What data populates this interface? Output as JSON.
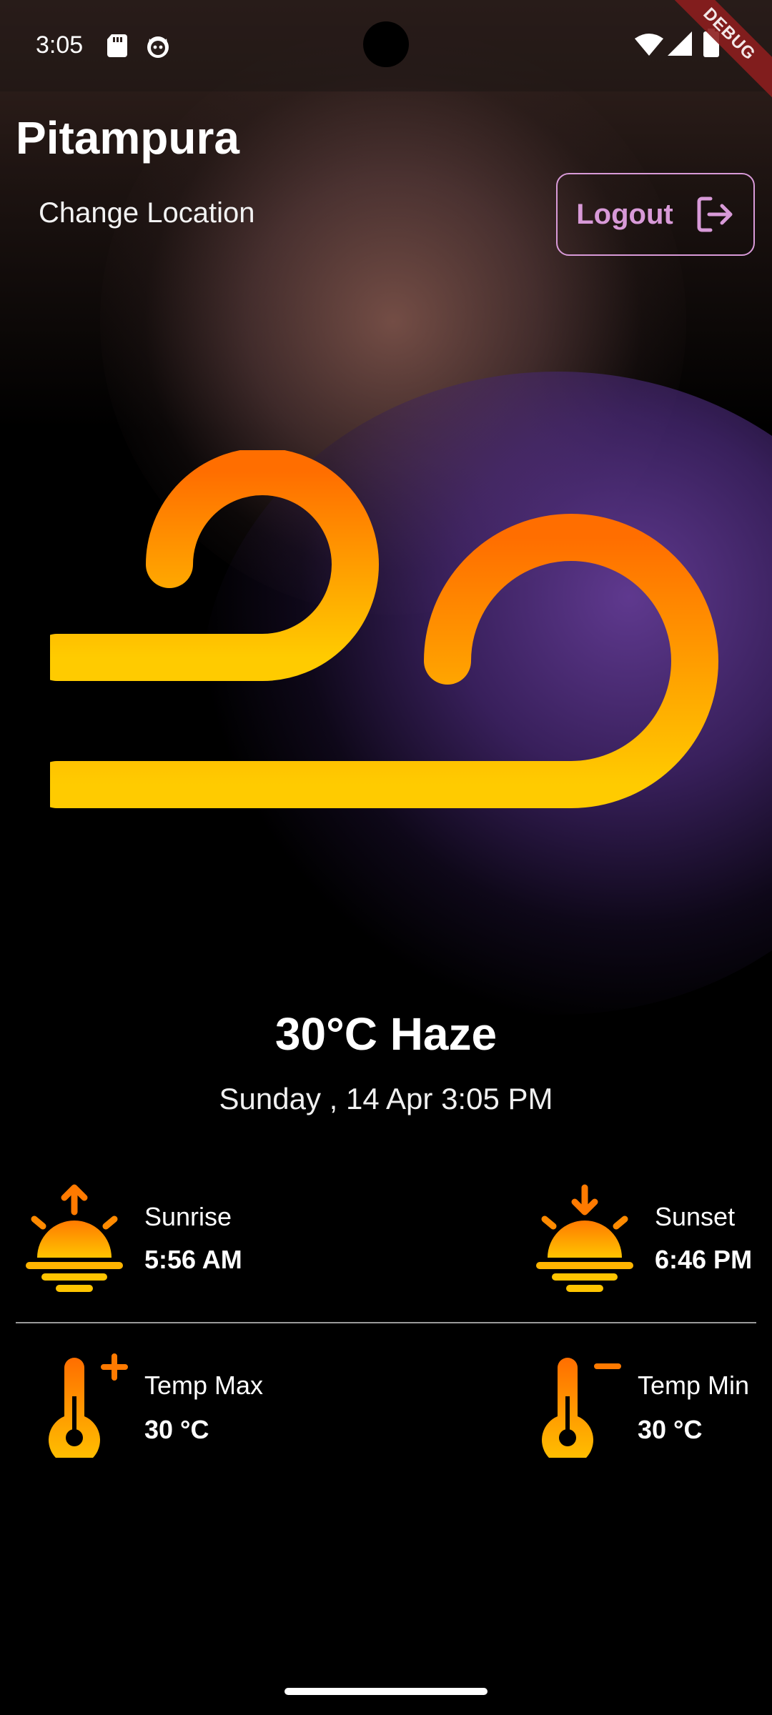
{
  "status_bar": {
    "time": "3:05",
    "debug_label": "DEBUG"
  },
  "header": {
    "location": "Pitampura",
    "change_location_label": "Change Location",
    "logout_label": "Logout"
  },
  "weather": {
    "icon": "wind-haze-icon",
    "temperature_condition": "30°C Haze",
    "date_time": "Sunday , 14 Apr 3:05 PM"
  },
  "details": {
    "sunrise": {
      "label": "Sunrise",
      "value": "5:56 AM",
      "icon": "sunrise-icon"
    },
    "sunset": {
      "label": "Sunset",
      "value": "6:46 PM",
      "icon": "sunset-icon"
    },
    "temp_max": {
      "label": "Temp Max",
      "value": "30 °C",
      "icon": "thermometer-plus-icon"
    },
    "temp_min": {
      "label": "Temp Min",
      "value": "30 °C",
      "icon": "thermometer-minus-icon"
    }
  },
  "colors": {
    "accent_orange": "#FF7A00",
    "accent_yellow": "#FFC400",
    "logout_purple": "#D89AD8",
    "background": "#000000"
  }
}
